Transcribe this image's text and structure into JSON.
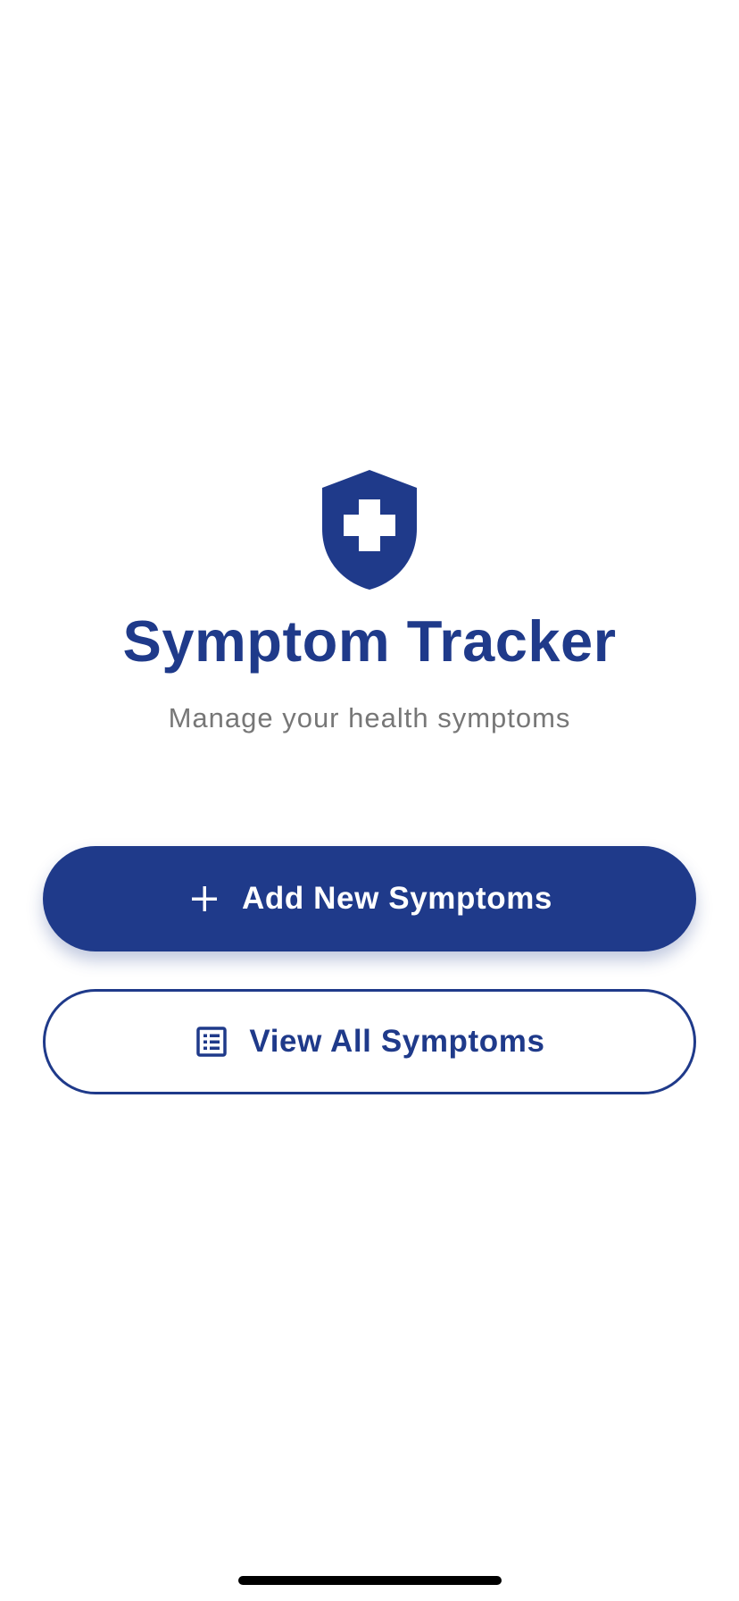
{
  "app": {
    "title": "Symptom Tracker",
    "subtitle": "Manage your health symptoms",
    "logo_icon": "shield-plus-icon"
  },
  "actions": {
    "add": {
      "label": "Add New Symptoms",
      "icon": "plus-icon"
    },
    "view": {
      "label": "View All Symptoms",
      "icon": "list-icon"
    }
  },
  "colors": {
    "primary": "#1f3a8a",
    "subtitle": "#777777",
    "background": "#ffffff",
    "on_primary": "#ffffff"
  }
}
